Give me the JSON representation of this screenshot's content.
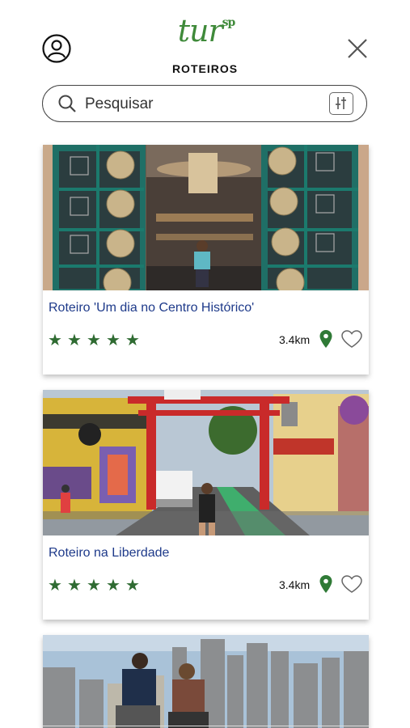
{
  "header": {
    "logo_text": "tur",
    "logo_suffix": "sp",
    "page_title": "ROTEIROS"
  },
  "search": {
    "placeholder": "Pesquisar"
  },
  "routes": [
    {
      "title": "Roteiro 'Um dia no Centro Histórico'",
      "rating": 5,
      "distance": "3.4km"
    },
    {
      "title": "Roteiro na Liberdade",
      "rating": 5,
      "distance": "3.4km"
    }
  ],
  "colors": {
    "brand_green": "#3f8a3a",
    "title_blue": "#1e3a8a",
    "star_green": "#2f6b32"
  },
  "icons": [
    "user-icon",
    "close-icon",
    "search-icon",
    "filter-icon",
    "star-icon",
    "pin-icon",
    "heart-icon"
  ]
}
